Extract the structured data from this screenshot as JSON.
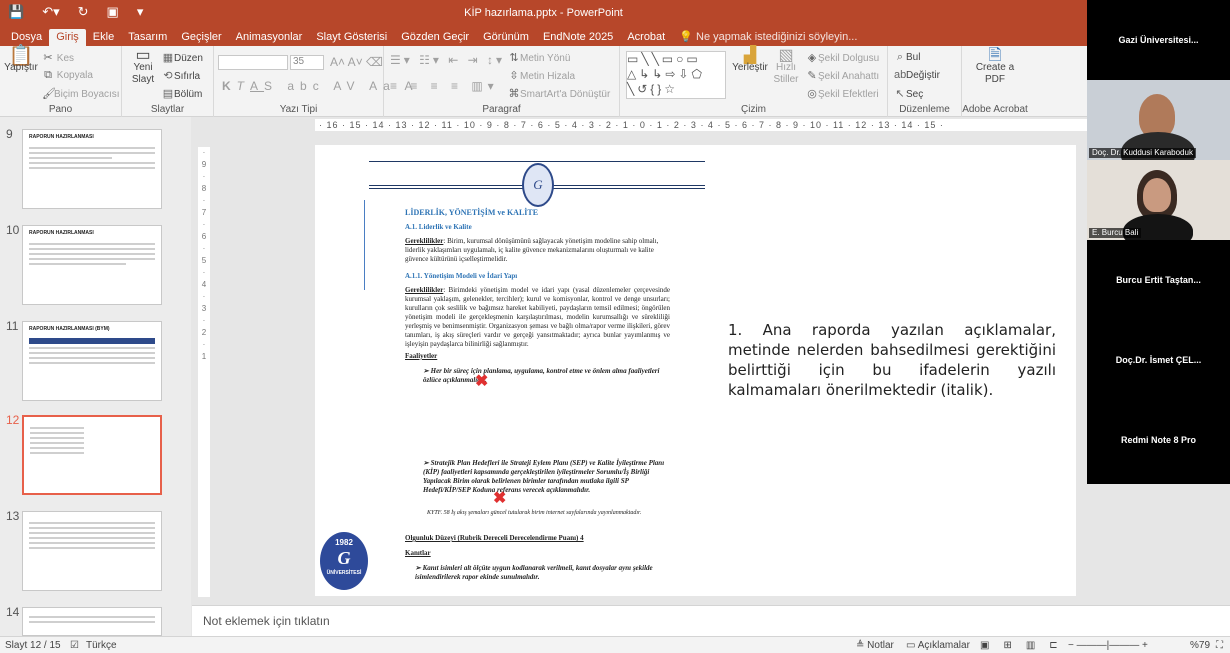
{
  "app": {
    "title": "KİP hazırlama.pptx - PowerPoint"
  },
  "tabs": [
    "Dosya",
    "Giriş",
    "Ekle",
    "Tasarım",
    "Geçişler",
    "Animasyonlar",
    "Slayt Gösterisi",
    "Gözden Geçir",
    "Görünüm",
    "EndNote 2025",
    "Acrobat"
  ],
  "search_hint": "Ne yapmak istediğinizi söyleyin...",
  "ribbon": {
    "pano": {
      "label": "Pano",
      "paste": "Yapıştır",
      "cut": "Kes",
      "copy": "Kopyala",
      "format_painter": "Biçim Boyacısı"
    },
    "slaytlar": {
      "label": "Slaytlar",
      "new_slide": "Yeni Slayt",
      "layout": "Düzen",
      "reset": "Sıfırla",
      "section": "Bölüm"
    },
    "yazi_tipi": {
      "label": "Yazı Tipi",
      "font_size": "35"
    },
    "paragraf": {
      "label": "Paragraf",
      "text_direction": "Metin Yönü",
      "align_text": "Metin Hizala",
      "smartart": "SmartArt'a Dönüştür"
    },
    "cizim": {
      "label": "Çizim",
      "arrange": "Yerleştir",
      "quick_styles": "Hızlı Stiller",
      "fill": "Şekil Dolgusu",
      "outline": "Şekil Anahattı",
      "effects": "Şekil Efektleri"
    },
    "duzenleme": {
      "label": "Düzenleme",
      "find": "Bul",
      "replace": "Değiştir",
      "select": "Seç"
    },
    "adobe": {
      "label": "Adobe Acrobat",
      "create_pdf": "Create a PDF"
    }
  },
  "thumbnails": [
    {
      "num": "9",
      "title": "RAPORUN HAZIRLANMASI"
    },
    {
      "num": "10",
      "title": "RAPORUN HAZIRLANMASI"
    },
    {
      "num": "11",
      "title": "RAPORUN HAZIRLANMASI (BYM)"
    },
    {
      "num": "12",
      "title": ""
    },
    {
      "num": "13",
      "title": ""
    },
    {
      "num": "14",
      "title": ""
    }
  ],
  "ruler": "· 16 · 15 · 14 · 13 · 12 · 11 · 10 · 9 · 8 · 7 · 6 · 5 · 4 · 3 · 2 · 1 · 0 · 1 · 2 · 3 · 4 · 5 · 6 · 7 · 8 · 9 · 10 · 11 · 12 · 13 · 14 · 15 ·",
  "slide": {
    "heading": "LİDERLİK, YÖNETİŞİM ve KALİTE",
    "sub1": "A.1. Liderlik ve Kalite",
    "p1_label": "Gereklilikler",
    "p1": ": Birim, kurumsal dönüşümünü sağlayacak yönetişim modeline sahip olmalı, liderlik yaklaşımları uygulamalı, iç kalite güvence mekanizmalarını oluşturmalı ve kalite güvence kültürünü içselleştirmelidir.",
    "sub2": "A.1.1. Yönetişim Modeli ve İdari Yapı",
    "p2_label": "Gereklilikler",
    "p2": ": Birimdeki yönetişim model ve idari yapı (yasal düzenlemeler çerçevesinde kurumsal yaklaşım, gelenekler, tercihler); kurul ve komisyonlar, kontrol ve denge unsurları; kurulların çok seslilik ve bağımsız hareket kabiliyeti, paydaşların temsil edilmesi; öngörülen yönetişim modeli ile gerçekleşmenin karşılaştırılması, modelin kurumsallığı ve sürekliliği yerleşmiş ve benimsenmiştir. Organizasyon şeması ve bağlı olma/rapor verme ilişkileri, görev tanımları, iş akış süreçleri vardır ve gerçeği yansıtmaktadır; ayrıca bunlar yayımlanmış ve işleyişin paydaşlarca bilinirliği sağlanmıştır.",
    "faaliyetler": "Faaliyetler",
    "b1": "Her bir süreç için planlama, uygulama, kontrol etme ve önlem alma faaliyetleri özlüce açıklanmalıdır.",
    "b2": "Stratejik Plan Hedefleri ile Strateji Eylem Planı (SEP) ve Kalite İyileştirme Planı (KİP) faaliyetleri kapsamında gerçekleştirilen iyileştirmeler Sorumlu/İş Birliği Yapılacak Birim olarak belirlenen birimler tarafından mutlaka ilgili SP Hedefi/KİP/SEP Koduna referans verecek açıklanmalıdır.",
    "kytf": "KYTF. 58 İş akış şemaları güncel tutularak birim internet sayfalarında yayınlanmaktadır.",
    "olgunluk": "Olgunluk Düzeyi (Rubrik Dereceli Derecelendirme Puanı)     4",
    "kanitlar": "Kanıtlar",
    "b3": "Kanıt isimleri alt ölçüte uygun kodlanarak verilmeli, kanıt dosyalar aynı şekilde isimlendirilerek rapor ekinde sunulmalıdır.",
    "logo_year": "1982",
    "logo_text": "ÜNİVERSİTESİ",
    "note": "1. Ana raporda yazılan açıklamalar, metinde nelerden bahsedilmesi gerektiğini belirttiği için bu ifadelerin yazılı kalmamaları önerilmektedir (italik)."
  },
  "notes_placeholder": "Not eklemek için tıklatın",
  "status": {
    "slide": "Slayt 12 / 15",
    "lang": "Türkçe",
    "notes": "Notlar",
    "comments": "Açıklamalar",
    "zoom": "%79"
  },
  "participants": [
    {
      "name": "Gazi Üniversitesi...",
      "camera": false
    },
    {
      "name": "Doç. Dr. Kuddusi Karaboduk",
      "camera": true
    },
    {
      "name": "E. Burcu Bali",
      "camera": true
    },
    {
      "name": "Burcu Ertit Taştan...",
      "camera": false
    },
    {
      "name": "Doç.Dr. İsmet ÇEL...",
      "camera": false
    },
    {
      "name": "Redmi Note 8 Pro",
      "camera": false
    }
  ],
  "colors": {
    "accent": "#b7472a",
    "slide_heading": "#2e74b5",
    "mark": "#e03030"
  }
}
